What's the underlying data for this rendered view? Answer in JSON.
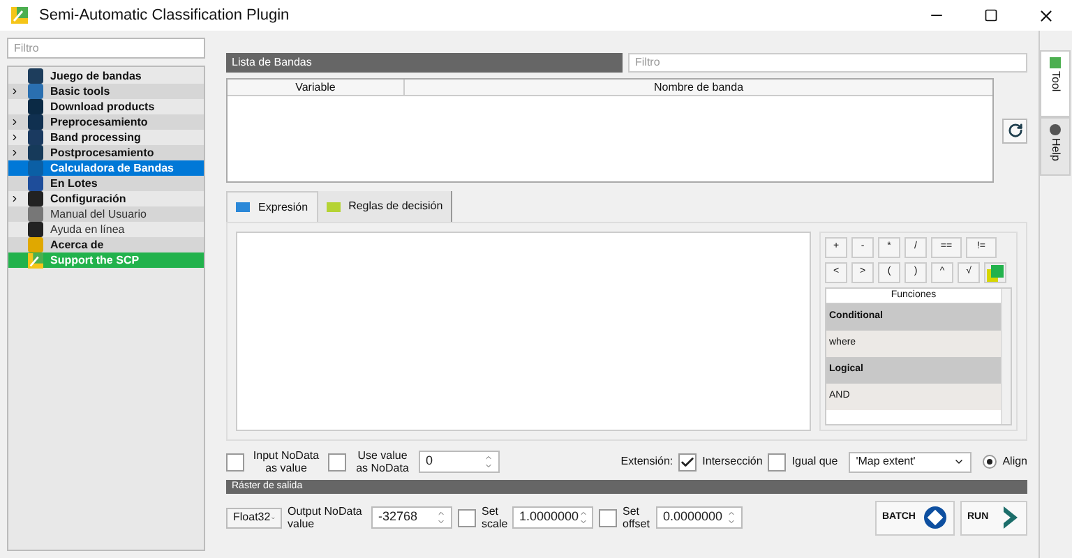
{
  "window": {
    "title": "Semi-Automatic Classification Plugin"
  },
  "sidebar": {
    "filter_placeholder": "Filtro",
    "items": [
      {
        "label": "Juego de bandas",
        "kind": "tool",
        "expandable": false,
        "selected": false
      },
      {
        "label": "Basic tools",
        "kind": "tool",
        "expandable": true,
        "selected": false
      },
      {
        "label": "Download products",
        "kind": "tool",
        "expandable": false,
        "selected": false
      },
      {
        "label": "Preprocesamiento",
        "kind": "tool",
        "expandable": true,
        "selected": false
      },
      {
        "label": "Band processing",
        "kind": "tool",
        "expandable": true,
        "selected": false
      },
      {
        "label": "Postprocesamiento",
        "kind": "tool",
        "expandable": true,
        "selected": false
      },
      {
        "label": "Calculadora de Bandas",
        "kind": "tool",
        "expandable": false,
        "selected": true
      },
      {
        "label": "En Lotes",
        "kind": "tool",
        "expandable": false,
        "selected": false
      },
      {
        "label": "Configuración",
        "kind": "tool",
        "expandable": true,
        "selected": false
      },
      {
        "label": "Manual del Usuario",
        "kind": "link",
        "expandable": false,
        "selected": false
      },
      {
        "label": "Ayuda en línea",
        "kind": "link",
        "expandable": false,
        "selected": false
      },
      {
        "label": "Acerca de",
        "kind": "tool",
        "expandable": false,
        "selected": false
      },
      {
        "label": "Support the SCP",
        "kind": "support",
        "expandable": false,
        "selected": false
      }
    ]
  },
  "band_list": {
    "title": "Lista de Bandas",
    "filter_placeholder": "Filtro",
    "columns": [
      "Variable",
      "Nombre de banda"
    ]
  },
  "tabs": [
    {
      "label": "Expresión",
      "selected": true
    },
    {
      "label": "Reglas de decisión",
      "selected": false
    }
  ],
  "operators": [
    [
      "+",
      "-",
      "*",
      "/",
      "==",
      "!="
    ],
    [
      "<",
      ">",
      "(",
      ")",
      "^",
      "√"
    ]
  ],
  "functions": {
    "title": "Funciones",
    "rows": [
      {
        "label": "Conditional",
        "kind": "group"
      },
      {
        "label": "where",
        "kind": "item"
      },
      {
        "label": "Logical",
        "kind": "group"
      },
      {
        "label": "AND",
        "kind": "item"
      }
    ]
  },
  "options": {
    "input_nodata": {
      "label": "Input NoData as value",
      "checked": false
    },
    "use_value_nodata": {
      "label": "Use value as NoData",
      "checked": false
    },
    "nodata_value": "0",
    "extent_label": "Extensión:",
    "intersection": {
      "label": "Intersección",
      "checked": true
    },
    "same_as": {
      "label": "Igual que",
      "checked": false
    },
    "extent_value": "'Map extent'",
    "align": {
      "label": "Align",
      "checked": true
    }
  },
  "output": {
    "title": "Ráster de salida",
    "data_type": "Float32",
    "nodata_label": "Output NoData value",
    "nodata_value": "-32768",
    "set_scale": {
      "label": "Set scale",
      "checked": false
    },
    "scale_value": "1.0000000",
    "set_offset": {
      "label": "Set offset",
      "checked": false
    },
    "offset_value": "0.0000000",
    "batch": "BATCH",
    "run": "RUN"
  },
  "side_tabs": [
    {
      "label": "Tool",
      "selected": true
    },
    {
      "label": "Help",
      "selected": false
    }
  ]
}
